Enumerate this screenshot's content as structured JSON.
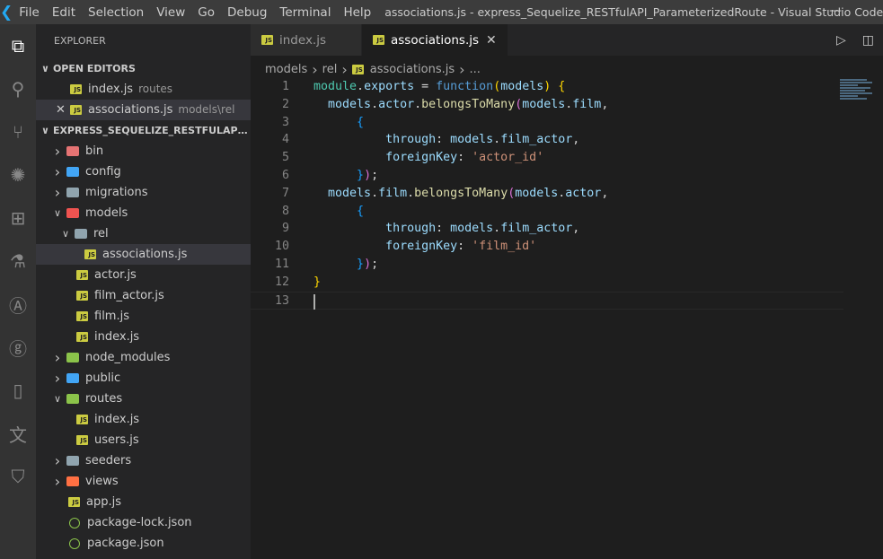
{
  "titlebar": {
    "menus": [
      "File",
      "Edit",
      "Selection",
      "View",
      "Go",
      "Debug",
      "Terminal",
      "Help"
    ],
    "title": "associations.js - express_Sequelize_RESTfulAPI_ParameterizedRoute - Visual Studio Code"
  },
  "activity": [
    "files-icon",
    "search-icon",
    "source-control-icon",
    "debug-icon",
    "extensions-icon",
    "test-flask-icon",
    "angular-icon",
    "git-graph-icon",
    "device-icon",
    "translate-icon",
    "remote-icon"
  ],
  "sidebar": {
    "title": "EXPLORER",
    "open_editors_label": "OPEN EDITORS",
    "open_editors": [
      {
        "name": "index.js",
        "desc": "routes"
      },
      {
        "name": "associations.js",
        "desc": "models\\rel"
      }
    ],
    "project_label": "EXPRESS_SEQUELIZE_RESTFULAPI_PAR...",
    "tree": [
      {
        "name": "bin",
        "type": "folder",
        "depth": 0,
        "color": "#e57373",
        "open": false
      },
      {
        "name": "config",
        "type": "folder",
        "depth": 0,
        "color": "#42a5f5",
        "open": false
      },
      {
        "name": "migrations",
        "type": "folder",
        "depth": 0,
        "color": "#90a4ae",
        "open": false
      },
      {
        "name": "models",
        "type": "folder",
        "depth": 0,
        "color": "#ef5350",
        "open": true
      },
      {
        "name": "rel",
        "type": "folder",
        "depth": 1,
        "color": "#90a4ae",
        "open": true
      },
      {
        "name": "associations.js",
        "type": "js",
        "depth": 2,
        "selected": true
      },
      {
        "name": "actor.js",
        "type": "js",
        "depth": 1
      },
      {
        "name": "film_actor.js",
        "type": "js",
        "depth": 1
      },
      {
        "name": "film.js",
        "type": "js",
        "depth": 1
      },
      {
        "name": "index.js",
        "type": "js",
        "depth": 1
      },
      {
        "name": "node_modules",
        "type": "folder",
        "depth": 0,
        "color": "#8bc34a",
        "open": false
      },
      {
        "name": "public",
        "type": "folder",
        "depth": 0,
        "color": "#42a5f5",
        "open": false
      },
      {
        "name": "routes",
        "type": "folder",
        "depth": 0,
        "color": "#8bc34a",
        "open": true
      },
      {
        "name": "index.js",
        "type": "js",
        "depth": 1
      },
      {
        "name": "users.js",
        "type": "js",
        "depth": 1
      },
      {
        "name": "seeders",
        "type": "folder",
        "depth": 0,
        "color": "#90a4ae",
        "open": false
      },
      {
        "name": "views",
        "type": "folder",
        "depth": 0,
        "color": "#ff7043",
        "open": false
      },
      {
        "name": "app.js",
        "type": "js",
        "depth": 0
      },
      {
        "name": "package-lock.json",
        "type": "json",
        "depth": 0
      },
      {
        "name": "package.json",
        "type": "json",
        "depth": 0
      }
    ]
  },
  "tabs": [
    {
      "label": "index.js",
      "active": false
    },
    {
      "label": "associations.js",
      "active": true
    }
  ],
  "breadcrumb": [
    "models",
    "rel",
    "associations.js",
    "..."
  ],
  "colors": {
    "var": "#9cdcfe",
    "fn": "#dcdcaa",
    "kw": "#569cd6",
    "str": "#ce9178",
    "type": "#4ec9b0",
    "b1": "#ffd700",
    "b2": "#da70d6",
    "b3": "#179fff",
    "p": "#d4d4d4"
  },
  "code": [
    [
      [
        "type",
        "module"
      ],
      [
        "p",
        "."
      ],
      [
        "var",
        "exports"
      ],
      [
        "p",
        " = "
      ],
      [
        "kw",
        "function"
      ],
      [
        "b1",
        "("
      ],
      [
        "var",
        "models"
      ],
      [
        "b1",
        ")"
      ],
      [
        "p",
        " "
      ],
      [
        "b1",
        "{"
      ]
    ],
    [
      [
        "p",
        "  "
      ],
      [
        "var",
        "models"
      ],
      [
        "p",
        "."
      ],
      [
        "var",
        "actor"
      ],
      [
        "p",
        "."
      ],
      [
        "fn",
        "belongsToMany"
      ],
      [
        "b2",
        "("
      ],
      [
        "var",
        "models"
      ],
      [
        "p",
        "."
      ],
      [
        "var",
        "film"
      ],
      [
        "p",
        ","
      ]
    ],
    [
      [
        "p",
        "      "
      ],
      [
        "b3",
        "{"
      ]
    ],
    [
      [
        "p",
        "          "
      ],
      [
        "var",
        "through"
      ],
      [
        "p",
        ": "
      ],
      [
        "var",
        "models"
      ],
      [
        "p",
        "."
      ],
      [
        "var",
        "film_actor"
      ],
      [
        "p",
        ","
      ]
    ],
    [
      [
        "p",
        "          "
      ],
      [
        "var",
        "foreignKey"
      ],
      [
        "p",
        ": "
      ],
      [
        "str",
        "'actor_id'"
      ]
    ],
    [
      [
        "p",
        "      "
      ],
      [
        "b3",
        "}"
      ],
      [
        "b2",
        ")"
      ],
      [
        "p",
        ";"
      ]
    ],
    [
      [
        "p",
        "  "
      ],
      [
        "var",
        "models"
      ],
      [
        "p",
        "."
      ],
      [
        "var",
        "film"
      ],
      [
        "p",
        "."
      ],
      [
        "fn",
        "belongsToMany"
      ],
      [
        "b2",
        "("
      ],
      [
        "var",
        "models"
      ],
      [
        "p",
        "."
      ],
      [
        "var",
        "actor"
      ],
      [
        "p",
        ","
      ]
    ],
    [
      [
        "p",
        "      "
      ],
      [
        "b3",
        "{"
      ]
    ],
    [
      [
        "p",
        "          "
      ],
      [
        "var",
        "through"
      ],
      [
        "p",
        ": "
      ],
      [
        "var",
        "models"
      ],
      [
        "p",
        "."
      ],
      [
        "var",
        "film_actor"
      ],
      [
        "p",
        ","
      ]
    ],
    [
      [
        "p",
        "          "
      ],
      [
        "var",
        "foreignKey"
      ],
      [
        "p",
        ": "
      ],
      [
        "str",
        "'film_id'"
      ]
    ],
    [
      [
        "p",
        "      "
      ],
      [
        "b3",
        "}"
      ],
      [
        "b2",
        ")"
      ],
      [
        "p",
        ";"
      ]
    ],
    [
      [
        "b1",
        "}"
      ]
    ],
    []
  ]
}
